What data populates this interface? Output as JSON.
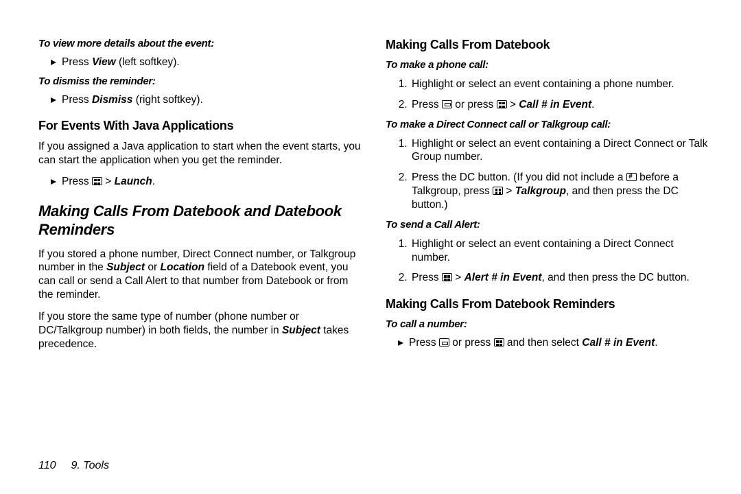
{
  "left": {
    "lead1": "To view more details about the event:",
    "bullet1_pre": "Press ",
    "bullet1_b": "View",
    "bullet1_post": " (left softkey).",
    "lead2": "To dismiss the reminder:",
    "bullet2_pre": "Press ",
    "bullet2_b": "Dismiss",
    "bullet2_post": " (right softkey).",
    "h3a": "For Events With Java Applications",
    "para_a": "If you assigned a Java application to start when the event starts, you can start the application when you get the reminder.",
    "bullet3_pre": "Press ",
    "bullet3_gt": " > ",
    "bullet3_bi": "Launch",
    "bullet3_post": ".",
    "h2": "Making Calls From Datebook and Datebook Reminders",
    "para_b_1": "If you stored a phone number, Direct Connect number, or Talkgroup number in the ",
    "para_b_bi1": "Subject",
    "para_b_2": " or ",
    "para_b_bi2": "Location",
    "para_b_3": " field of a Datebook event, you can call or send a Call Alert to that number from Datebook or from the reminder.",
    "para_c_1": "If you store the same type of number (phone number or DC/Talkgroup number) in both fields, the number in ",
    "para_c_bi": "Subject",
    "para_c_2": " takes precedence."
  },
  "right": {
    "h3a": "Making Calls From Datebook",
    "lead1": "To make a phone call:",
    "ol1_li1": "Highlight or select an event containing a phone number.",
    "ol1_li2_a": "Press ",
    "ol1_li2_b": " or press ",
    "ol1_li2_gt": " > ",
    "ol1_li2_bi": "Call # in Event",
    "ol1_li2_c": ".",
    "lead2": "To make a Direct Connect call or Talkgroup call:",
    "ol2_li1": "Highlight or select an event containing a Direct Connect or Talk Group number.",
    "ol2_li2_a": "Press the DC button. (If you did not include a ",
    "ol2_li2_b": " before a Talkgroup, press ",
    "ol2_li2_gt": " > ",
    "ol2_li2_bi": "Talkgroup",
    "ol2_li2_c": ", and then press the DC button.)",
    "lead3": "To send a Call Alert:",
    "ol3_li1": "Highlight or select an event containing a Direct Connect number.",
    "ol3_li2_a": "Press ",
    "ol3_li2_gt": " > ",
    "ol3_li2_bi": "Alert # in Event",
    "ol3_li2_b": ", and then press the DC button.",
    "h3b": "Making Calls From Datebook Reminders",
    "lead4": "To call a number:",
    "bullet4_a": "Press ",
    "bullet4_b": " or press ",
    "bullet4_c": " and then select ",
    "bullet4_bi": "Call # in Event",
    "bullet4_d": "."
  },
  "footer": {
    "page": "110",
    "section": "9. Tools"
  }
}
